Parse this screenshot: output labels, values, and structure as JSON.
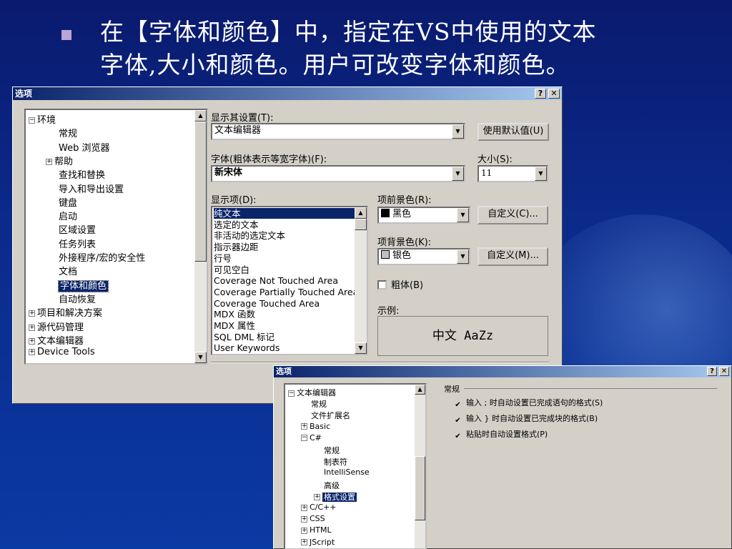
{
  "slide": {
    "title_line1": "在【字体和颜色】中，指定在VS中使用的文本",
    "title_line2": "字体,大小和颜色。用户可改变字体和颜色。"
  },
  "dialog1": {
    "title": "选项",
    "help_btn": "?",
    "close_btn": "✕",
    "tree": [
      {
        "label": "环境",
        "exp": "−"
      },
      {
        "label": "常规"
      },
      {
        "label": "Web 浏览器"
      },
      {
        "label": "帮助",
        "exp": "+"
      },
      {
        "label": "查找和替换"
      },
      {
        "label": "导入和导出设置"
      },
      {
        "label": "键盘"
      },
      {
        "label": "启动"
      },
      {
        "label": "区域设置"
      },
      {
        "label": "任务列表"
      },
      {
        "label": "外接程序/宏的安全性"
      },
      {
        "label": "文档"
      },
      {
        "label": "字体和颜色",
        "selected": true
      },
      {
        "label": "自动恢复"
      },
      {
        "label": "项目和解决方案",
        "exp": "+"
      },
      {
        "label": "源代码管理",
        "exp": "+"
      },
      {
        "label": "文本编辑器",
        "exp": "+"
      },
      {
        "label": "Device Tools",
        "exp": "+"
      }
    ],
    "show_settings_label": "显示其设置(T):",
    "show_settings_value": "文本编辑器",
    "use_defaults_btn": "使用默认值(U)",
    "font_label": "字体(粗体表示等宽字体)(F):",
    "font_value": "新宋体",
    "size_label": "大小(S):",
    "size_value": "11",
    "display_items_label": "显示项(D):",
    "display_items": [
      "纯文本",
      "选定的文本",
      "非活动的选定文本",
      "指示器边距",
      "行号",
      "可见空白",
      "Coverage Not Touched Area",
      "Coverage Partially Touched Area",
      "Coverage Touched Area",
      "MDX 函数",
      "MDX 属性",
      "SQL DML 标记",
      "User Keywords"
    ],
    "fg_label": "项前景色(R):",
    "fg_value": "黑色",
    "fg_custom_btn": "自定义(C)...",
    "bg_label": "项背景色(K):",
    "bg_value": "银色",
    "bg_custom_btn": "自定义(M)...",
    "bold_label": "粗体(B)",
    "sample_label": "示例:",
    "sample_text": "中文 AaZz",
    "colors": {
      "fg": "#000000",
      "bg": "#c0c0c0"
    }
  },
  "dialog2": {
    "title": "选项",
    "help_btn": "?",
    "close_btn": "✕",
    "tree": [
      {
        "label": "文本编辑器",
        "exp": "−"
      },
      {
        "label": "常规"
      },
      {
        "label": "文件扩展名"
      },
      {
        "label": "Basic",
        "exp": "+"
      },
      {
        "label": "C#",
        "exp": "−"
      },
      {
        "label": "常规"
      },
      {
        "label": "制表符"
      },
      {
        "label": "IntelliSense"
      },
      {
        "label": "高级"
      },
      {
        "label": "格式设置",
        "exp": "+",
        "selected": true
      },
      {
        "label": "C/C++",
        "exp": "+"
      },
      {
        "label": "CSS",
        "exp": "+"
      },
      {
        "label": "HTML",
        "exp": "+"
      },
      {
        "label": "JScript",
        "exp": "+"
      }
    ],
    "group_title": "常规",
    "options": [
      {
        "label": "输入 ; 时自动设置已完成语句的格式(S)",
        "checked": true
      },
      {
        "label": "输入 } 时自动设置已完成块的格式(B)",
        "checked": true
      },
      {
        "label": "粘贴时自动设置格式(P)",
        "checked": true
      }
    ]
  }
}
